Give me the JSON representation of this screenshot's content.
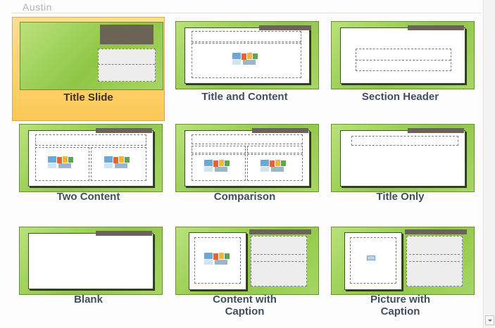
{
  "gallery": {
    "section_header": "Austin",
    "layouts": [
      {
        "id": "title-slide",
        "label": "Title Slide",
        "selected": true
      },
      {
        "id": "title-and-content",
        "label": "Title and Content",
        "selected": false
      },
      {
        "id": "section-header",
        "label": "Section Header",
        "selected": false
      },
      {
        "id": "two-content",
        "label": "Two Content",
        "selected": false
      },
      {
        "id": "comparison",
        "label": "Comparison",
        "selected": false
      },
      {
        "id": "title-only",
        "label": "Title Only",
        "selected": false
      },
      {
        "id": "blank",
        "label": "Blank",
        "selected": false
      },
      {
        "id": "content-with-caption",
        "label_line1": "Content with",
        "label_line2": "Caption",
        "selected": false
      },
      {
        "id": "picture-with-caption",
        "label_line1": "Picture with",
        "label_line2": "Caption",
        "selected": false
      }
    ]
  },
  "colors": {
    "theme_green": "#8fc646",
    "selection_highlight": "#fcc856",
    "title_bar_brown": "#6b6456"
  }
}
